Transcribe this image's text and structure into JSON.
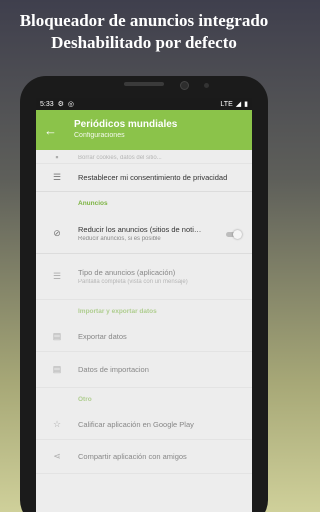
{
  "headline": {
    "line1": "Bloqueador de anuncios integrado",
    "line2": "Deshabilitado por defecto"
  },
  "status_bar": {
    "time": "5:33",
    "icons": [
      "settings-icon",
      "sync-icon"
    ],
    "network": "LTE"
  },
  "app_bar": {
    "title": "Periódicos mundiales",
    "subtitle": "Configuraciones"
  },
  "rows_top": [
    {
      "label": "Borrar cookies, datos del sitio...",
      "icon": "trash-icon"
    },
    {
      "label": "Restablecer mi consentimiento de privacidad",
      "icon": "list-icon"
    }
  ],
  "sections": {
    "ads": "Anuncios",
    "import_export": "Importar y exportar datos",
    "others": "Otro"
  },
  "ads_rows": {
    "reduce": {
      "title": "Reducir los anuncios (sitios de noti…",
      "subtitle": "Reducir anuncios, si es posible",
      "toggle_on": false
    },
    "type": {
      "title": "Tipo de anuncios (aplicación)",
      "subtitle": "Pantalla completa (vista con un mensaje)"
    }
  },
  "import_rows": [
    {
      "label": "Exportar datos"
    },
    {
      "label": "Datos de importacion"
    }
  ],
  "other_rows": [
    {
      "label": "Calificar aplicación en Google Play"
    },
    {
      "label": "Compartir aplicación con amigos"
    }
  ],
  "colors": {
    "accent": "#8bc34a",
    "section_text": "#7cb342"
  }
}
